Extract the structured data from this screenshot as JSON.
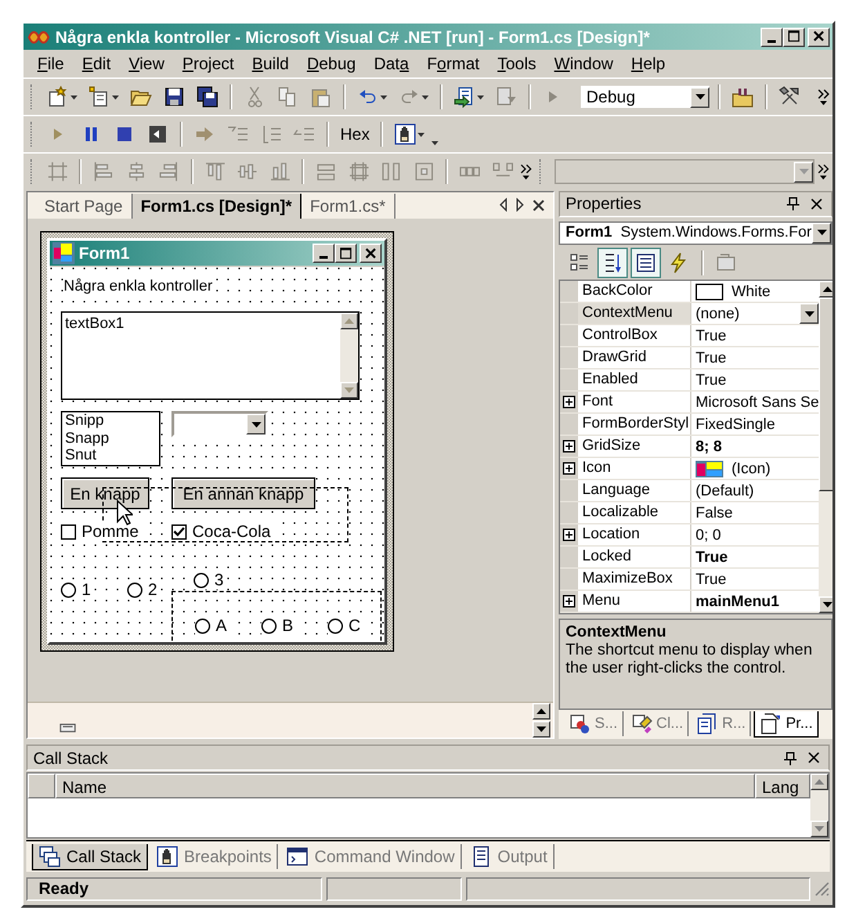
{
  "window": {
    "title": "Några enkla kontroller - Microsoft Visual C# .NET [run] - Form1.cs [Design]*"
  },
  "menu": [
    {
      "key": "F",
      "after": "ile"
    },
    {
      "key": "E",
      "after": "dit"
    },
    {
      "key": "V",
      "after": "iew"
    },
    {
      "key": "P",
      "after": "roject"
    },
    {
      "key": "B",
      "after": "uild"
    },
    {
      "key": "D",
      "after": "ebug"
    },
    {
      "before": "Dat",
      "key": "a"
    },
    {
      "before": "F",
      "key": "o",
      "after": "rmat"
    },
    {
      "key": "T",
      "after": "ools"
    },
    {
      "key": "W",
      "after": "indow"
    },
    {
      "key": "H",
      "after": "elp"
    }
  ],
  "toolbar": {
    "configuration": "Debug",
    "hex": "Hex"
  },
  "doc_tabs": [
    {
      "label": "Start Page",
      "selected": false
    },
    {
      "label": "Form1.cs [Design]*",
      "selected": true
    },
    {
      "label": "Form1.cs*",
      "selected": false
    }
  ],
  "form": {
    "title": "Form1",
    "label": "Några enkla kontroller",
    "textbox": "textBox1",
    "listbox": [
      "Snipp",
      "Snapp",
      "Snut"
    ],
    "buttons": [
      "En knapp",
      "En annan knapp"
    ],
    "checkboxes": [
      {
        "label": "Pomme",
        "checked": false
      },
      {
        "label": "Coca-Cola",
        "checked": true
      }
    ],
    "radios": [
      {
        "label": "1",
        "selected": false
      },
      {
        "label": "2",
        "selected": false
      },
      {
        "label": "3",
        "selected": false
      }
    ],
    "group_radios": [
      {
        "label": "A",
        "selected": false
      },
      {
        "label": "B",
        "selected": false
      },
      {
        "label": "C",
        "selected": false
      }
    ]
  },
  "properties": {
    "title": "Properties",
    "object": "Form1",
    "type": "System.Windows.Forms.For",
    "view_buttons": [
      {
        "kind": "categorized",
        "selected": false
      },
      {
        "kind": "alphabetical",
        "selected": true
      },
      {
        "kind": "properties",
        "selected": true
      },
      {
        "kind": "events",
        "selected": false
      }
    ],
    "rows": [
      {
        "name": "BackColor",
        "value": "White",
        "kind": "color",
        "expandable": false,
        "bold": false,
        "selected": false
      },
      {
        "name": "ContextMenu",
        "value": "(none)",
        "kind": "dropdown",
        "expandable": false,
        "bold": false,
        "selected": true
      },
      {
        "name": "ControlBox",
        "value": "True",
        "kind": "text",
        "expandable": false,
        "bold": false,
        "selected": false
      },
      {
        "name": "DrawGrid",
        "value": "True",
        "kind": "text",
        "expandable": false,
        "bold": false,
        "selected": false
      },
      {
        "name": "Enabled",
        "value": "True",
        "kind": "text",
        "expandable": false,
        "bold": false,
        "selected": false
      },
      {
        "name": "Font",
        "value": "Microsoft Sans Se",
        "kind": "text",
        "expandable": true,
        "bold": false,
        "selected": false
      },
      {
        "name": "FormBorderStyl",
        "value": "FixedSingle",
        "kind": "text",
        "expandable": false,
        "bold": false,
        "selected": false
      },
      {
        "name": "GridSize",
        "value": "8; 8",
        "kind": "text",
        "expandable": true,
        "bold": true,
        "selected": false
      },
      {
        "name": "Icon",
        "value": "(Icon)",
        "kind": "icon",
        "expandable": true,
        "bold": false,
        "selected": false
      },
      {
        "name": "Language",
        "value": "(Default)",
        "kind": "text",
        "expandable": false,
        "bold": false,
        "selected": false
      },
      {
        "name": "Localizable",
        "value": "False",
        "kind": "text",
        "expandable": false,
        "bold": false,
        "selected": false
      },
      {
        "name": "Location",
        "value": "0; 0",
        "kind": "text",
        "expandable": true,
        "bold": false,
        "selected": false
      },
      {
        "name": "Locked",
        "value": "True",
        "kind": "text",
        "expandable": false,
        "bold": true,
        "selected": false
      },
      {
        "name": "MaximizeBox",
        "value": "True",
        "kind": "text",
        "expandable": false,
        "bold": false,
        "selected": false
      },
      {
        "name": "Menu",
        "value": "mainMenu1",
        "kind": "text",
        "expandable": true,
        "bold": true,
        "selected": false
      }
    ],
    "description": {
      "title": "ContextMenu",
      "text": "The shortcut menu to display when the user right-clicks the control."
    },
    "tabs": [
      {
        "label": "S...",
        "selected": false
      },
      {
        "label": "Cl...",
        "selected": false
      },
      {
        "label": "R...",
        "selected": false
      },
      {
        "label": "Pr...",
        "selected": true
      }
    ]
  },
  "call_stack": {
    "title": "Call Stack",
    "columns": [
      "Name",
      "Lang"
    ]
  },
  "bottom_tabs": [
    {
      "label": "Call Stack",
      "selected": true
    },
    {
      "label": "Breakpoints",
      "selected": false
    },
    {
      "label": "Command Window",
      "selected": false
    },
    {
      "label": "Output",
      "selected": false
    }
  ],
  "status_bar": {
    "text": "Ready"
  }
}
